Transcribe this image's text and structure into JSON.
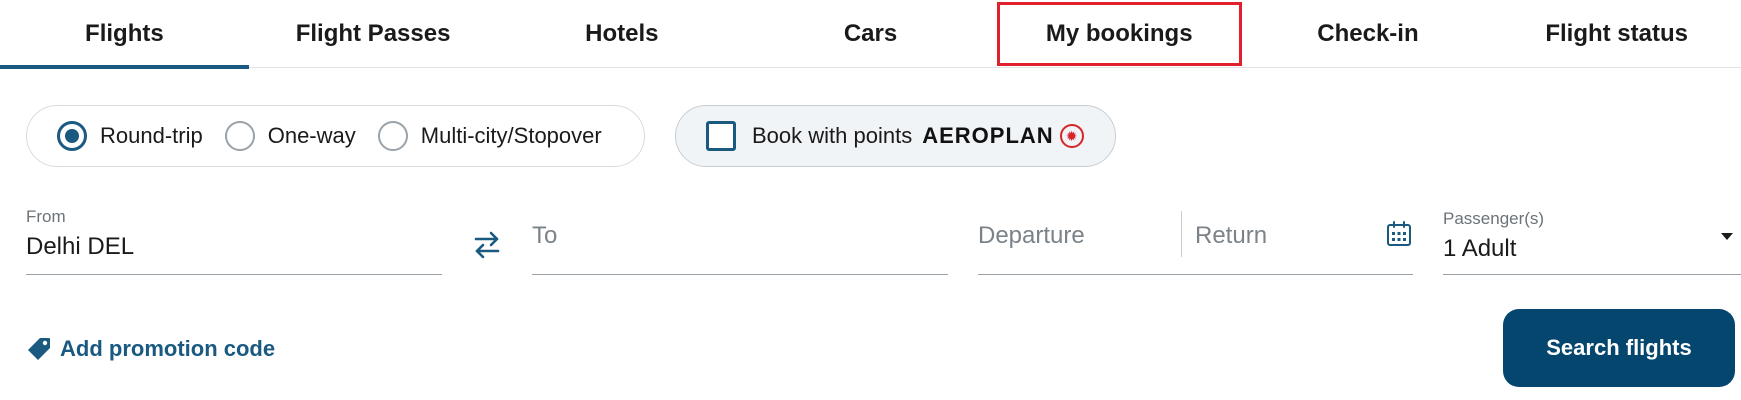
{
  "tabs": [
    {
      "label": "Flights"
    },
    {
      "label": "Flight Passes"
    },
    {
      "label": "Hotels"
    },
    {
      "label": "Cars"
    },
    {
      "label": "My bookings"
    },
    {
      "label": "Check-in"
    },
    {
      "label": "Flight status"
    }
  ],
  "active_tab": "Flights",
  "highlighted_tab": "My bookings",
  "trip_type": {
    "options": [
      {
        "label": "Round-trip",
        "selected": true
      },
      {
        "label": "One-way",
        "selected": false
      },
      {
        "label": "Multi-city/Stopover",
        "selected": false
      }
    ]
  },
  "points": {
    "label": "Book with points",
    "brand": "AEROPLAN",
    "checked": false
  },
  "from": {
    "label": "From",
    "value": "Delhi DEL"
  },
  "to": {
    "placeholder": "To"
  },
  "dates": {
    "departure_placeholder": "Departure",
    "return_placeholder": "Return"
  },
  "passengers": {
    "label": "Passenger(s)",
    "value": "1 Adult"
  },
  "promo": {
    "label": "Add promotion code"
  },
  "search": {
    "label": "Search flights"
  },
  "colors": {
    "accent": "#1a5a80",
    "button": "#05466f",
    "highlight_box": "#e0202c"
  },
  "icons": [
    "swap-icon",
    "calendar-icon",
    "tag-icon",
    "maple-leaf-icon",
    "chevron-down-icon"
  ]
}
